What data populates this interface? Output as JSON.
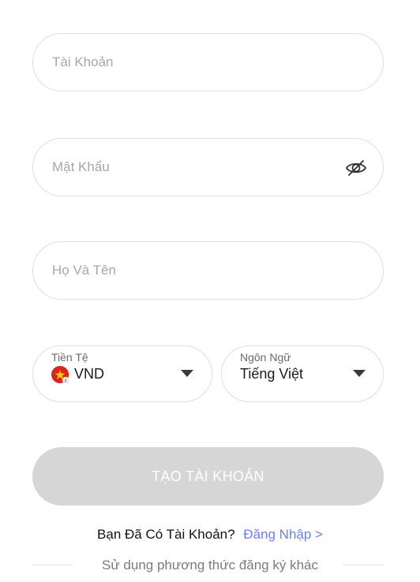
{
  "form": {
    "username_placeholder": "Tài Khoản",
    "password_placeholder": "Mật Khẩu",
    "fullname_placeholder": "Họ Và Tên"
  },
  "currency": {
    "label": "Tiền Tệ",
    "value": "VND",
    "flag_icon": "vietnam-flag-icon"
  },
  "language": {
    "label": "Ngôn Ngữ",
    "value": "Tiếng Việt"
  },
  "actions": {
    "create_account": "TẠO TÀI KHOẢN",
    "have_account": "Bạn Đã Có Tài Khoản?",
    "login_link": "Đăng Nhập >",
    "other_methods": "Sử dụng phương thức đăng ký khác"
  },
  "colors": {
    "link": "#6f80ee",
    "button_disabled": "#d6d6d6",
    "border": "#dedede",
    "flag_red": "#da251d",
    "flag_star": "#ffcd00"
  }
}
